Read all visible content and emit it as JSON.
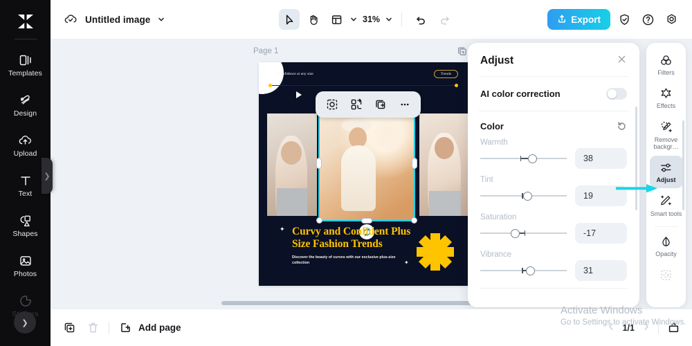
{
  "app": {
    "name": "CapCut Image Editor"
  },
  "sidebar": {
    "logo_icon": "capcut-logo-icon",
    "items": [
      {
        "label": "Templates",
        "icon": "templates-icon"
      },
      {
        "label": "Design",
        "icon": "design-icon"
      },
      {
        "label": "Upload",
        "icon": "upload-cloud-icon"
      },
      {
        "label": "Text",
        "icon": "text-icon"
      },
      {
        "label": "Shapes",
        "icon": "shapes-icon"
      },
      {
        "label": "Photos",
        "icon": "photos-icon"
      },
      {
        "label": "Stickers",
        "icon": "stickers-icon"
      }
    ],
    "collapse_icon": "chevron-right-icon",
    "more_icon": "chevron-down-icon"
  },
  "topbar": {
    "cloud_icon": "cloud-saved-icon",
    "doc_title": "Untitled image",
    "doc_title_caret": "chevron-down-icon",
    "tools": [
      {
        "name": "select-tool",
        "icon": "cursor-arrow-icon",
        "active": true
      },
      {
        "name": "hand-tool",
        "icon": "hand-icon",
        "active": false
      },
      {
        "name": "layout-tool",
        "icon": "layout-grid-icon",
        "active": false
      }
    ],
    "layout_caret": "chevron-down-icon",
    "zoom_value": "31%",
    "zoom_caret": "chevron-down-icon",
    "undo_icon": "undo-arrow-icon",
    "redo_icon": "redo-arrow-icon",
    "export_label": "Export",
    "export_icon": "upload-share-icon",
    "export_gradient_from": "#2e9df0",
    "export_gradient_to": "#17cfe8",
    "shield_icon": "shield-check-icon",
    "help_icon": "question-circle-icon",
    "settings_icon": "gear-icon"
  },
  "canvas": {
    "page_label": "Page 1",
    "page_duplicate_icon": "duplicate-page-icon",
    "floating_toolbar": [
      {
        "name": "crop-button",
        "icon": "crop-select-icon"
      },
      {
        "name": "flip-button",
        "icon": "flip-rotate-icon"
      },
      {
        "name": "duplicate-button",
        "icon": "duplicate-icon"
      },
      {
        "name": "more-button",
        "icon": "ellipsis-icon"
      }
    ],
    "rotate_icon": "rotate-handle-icon",
    "selection_color": "#18d2e8"
  },
  "design": {
    "kicker": "Confidence at any size",
    "badge": "Trends",
    "headline": "Curvy and Confident Plus Size Fashion Trends",
    "subtext": "Discover the beauty of curves with our exclusive plus-size collection",
    "accent_color": "#ffc400",
    "background_color": "#0a1025"
  },
  "adjust_panel": {
    "title": "Adjust",
    "close_icon": "close-icon",
    "ai_color_correction": {
      "label": "AI color correction",
      "enabled": false
    },
    "color_section": {
      "title": "Color",
      "reset_icon": "reset-icon"
    },
    "sliders": [
      {
        "name": "Warmth",
        "value": "38",
        "pct": 60
      },
      {
        "name": "Tint",
        "value": "19",
        "pct": 55
      },
      {
        "name": "Saturation",
        "value": "-17",
        "pct": 40
      },
      {
        "name": "Vibrance",
        "value": "31",
        "pct": 58
      }
    ]
  },
  "rail": {
    "items": [
      {
        "label": "Filters",
        "icon": "filters-icon",
        "selected": false,
        "dim": false
      },
      {
        "label": "Effects",
        "icon": "effects-icon",
        "selected": false,
        "dim": false
      },
      {
        "label": "Remove backgr…",
        "icon": "remove-bg-icon",
        "selected": false,
        "dim": false
      },
      {
        "label": "Adjust",
        "icon": "adjust-icon",
        "selected": true,
        "dim": false
      },
      {
        "label": "Smart tools",
        "icon": "smart-tools-icon",
        "selected": false,
        "dim": false
      },
      {
        "label": "Opacity",
        "icon": "opacity-icon",
        "selected": false,
        "dim": false
      },
      {
        "label": "",
        "icon": "mask-icon",
        "selected": false,
        "dim": true
      }
    ]
  },
  "bottombar": {
    "duplicate_icon": "duplicate-page-icon",
    "delete_icon": "trash-icon",
    "add_page_icon": "add-page-icon",
    "add_page_label": "Add page",
    "prev_icon": "chevron-left-icon",
    "next_icon": "chevron-right-icon",
    "page_count": "1/1",
    "fullscreen_icon": "present-icon"
  },
  "watermark": {
    "line1": "Activate Windows",
    "line2": "Go to Settings to activate Windows."
  },
  "annotation": {
    "arrow_color": "#18d6e8",
    "points_to": "Adjust"
  }
}
